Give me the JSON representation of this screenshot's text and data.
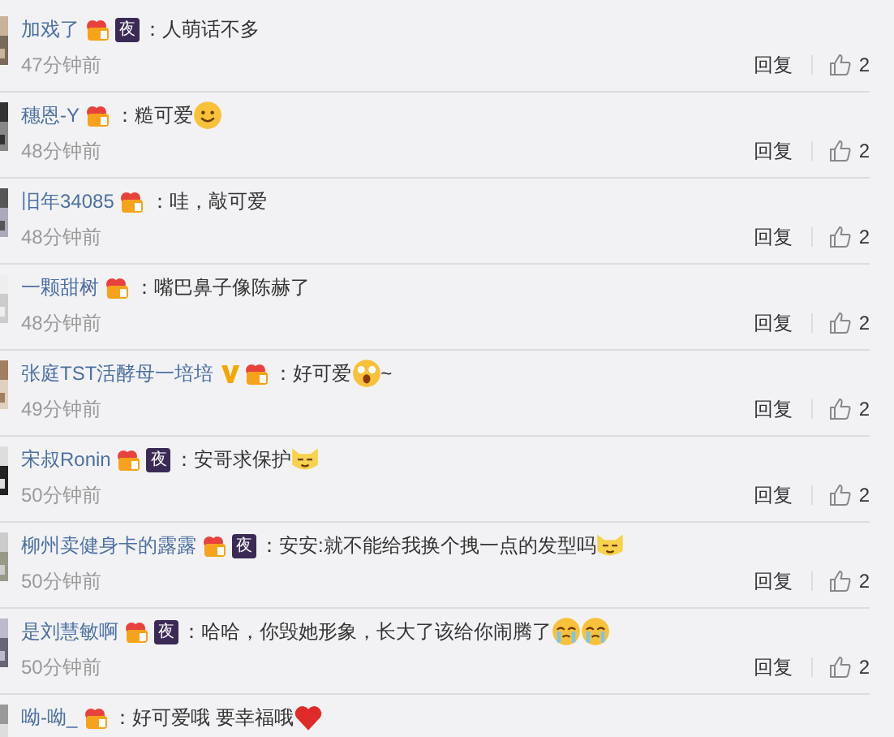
{
  "comments": [
    {
      "name": "加戏了",
      "badges": [
        {
          "kind": "vip"
        },
        {
          "kind": "night",
          "label": "夜"
        }
      ],
      "content": [
        {
          "kind": "text",
          "text": "：人萌话不多"
        }
      ],
      "time": "47分钟前",
      "reply": "回复",
      "likes": "2"
    },
    {
      "name": "穗恩-Y",
      "badges": [
        {
          "kind": "vip"
        }
      ],
      "content": [
        {
          "kind": "text",
          "text": "：糙可爱"
        },
        {
          "kind": "smile"
        }
      ],
      "time": "48分钟前",
      "reply": "回复",
      "likes": "2"
    },
    {
      "name": "旧年34085",
      "badges": [
        {
          "kind": "vip"
        }
      ],
      "content": [
        {
          "kind": "text",
          "text": "：哇，敲可爱"
        }
      ],
      "time": "48分钟前",
      "reply": "回复",
      "likes": "2"
    },
    {
      "name": "一颗甜树",
      "badges": [
        {
          "kind": "vip"
        }
      ],
      "content": [
        {
          "kind": "text",
          "text": "：嘴巴鼻子像陈赫了"
        }
      ],
      "time": "48分钟前",
      "reply": "回复",
      "likes": "2"
    },
    {
      "name": "张庭TST活酵母一培培",
      "badges": [
        {
          "kind": "verified"
        },
        {
          "kind": "vip"
        }
      ],
      "content": [
        {
          "kind": "text",
          "text": "：好可爱"
        },
        {
          "kind": "shocked"
        },
        {
          "kind": "text",
          "text": "~"
        }
      ],
      "time": "49分钟前",
      "reply": "回复",
      "likes": "2"
    },
    {
      "name": "宋叔Ronin",
      "badges": [
        {
          "kind": "vip"
        },
        {
          "kind": "night",
          "label": "夜"
        }
      ],
      "content": [
        {
          "kind": "text",
          "text": "：安哥求保护"
        },
        {
          "kind": "cat"
        }
      ],
      "time": "50分钟前",
      "reply": "回复",
      "likes": "2"
    },
    {
      "name": "柳州卖健身卡的露露",
      "badges": [
        {
          "kind": "vip"
        },
        {
          "kind": "night",
          "label": "夜"
        }
      ],
      "content": [
        {
          "kind": "text",
          "text": "：安安:就不能给我换个拽一点的发型吗"
        },
        {
          "kind": "cat"
        }
      ],
      "time": "50分钟前",
      "reply": "回复",
      "likes": "2"
    },
    {
      "name": "是刘慧敏啊",
      "badges": [
        {
          "kind": "vip"
        },
        {
          "kind": "night",
          "label": "夜"
        }
      ],
      "content": [
        {
          "kind": "text",
          "text": "：哈哈，你毁她形象，长大了该给你闹腾了"
        },
        {
          "kind": "cry"
        },
        {
          "kind": "cry"
        }
      ],
      "time": "50分钟前",
      "reply": "回复",
      "likes": "2"
    },
    {
      "name": "呦-呦_",
      "badges": [
        {
          "kind": "vip"
        }
      ],
      "content": [
        {
          "kind": "text",
          "text": "：好可爱哦 要幸福哦"
        },
        {
          "kind": "heart"
        }
      ]
    }
  ]
}
